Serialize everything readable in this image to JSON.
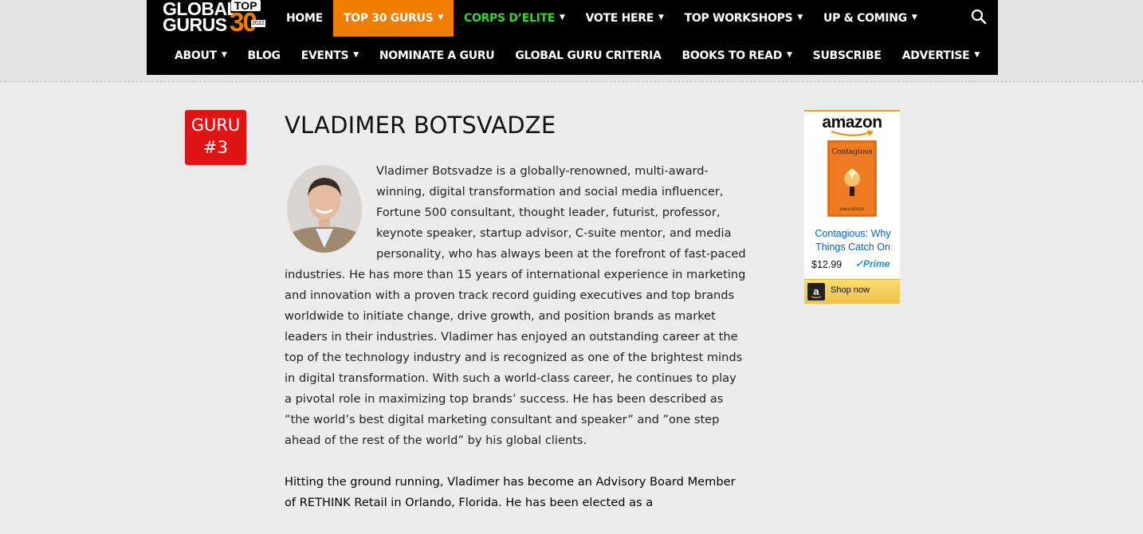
{
  "logo": {
    "line1": "GLOBAL",
    "line2": "GURUS",
    "top_label": "TOP",
    "number": "30",
    "year": "2022"
  },
  "nav": {
    "row1": [
      {
        "label": "HOME",
        "dropdown": false
      },
      {
        "label": "TOP 30 GURUS",
        "dropdown": true,
        "active": true
      },
      {
        "label": "CORPS D’ELITE",
        "dropdown": true,
        "highlight": "#34d62f"
      },
      {
        "label": "VOTE HERE",
        "dropdown": true
      },
      {
        "label": "TOP WORKSHOPS",
        "dropdown": true
      },
      {
        "label": "UP & COMING",
        "dropdown": true
      }
    ],
    "row2": [
      {
        "label": "ABOUT",
        "dropdown": true
      },
      {
        "label": "BLOG",
        "dropdown": false
      },
      {
        "label": "EVENTS",
        "dropdown": true
      },
      {
        "label": "NOMINATE A GURU",
        "dropdown": false
      },
      {
        "label": "GLOBAL GURU CRITERIA",
        "dropdown": false
      },
      {
        "label": "BOOKS TO READ",
        "dropdown": true
      },
      {
        "label": "SUBSCRIBE",
        "dropdown": false
      },
      {
        "label": "ADVERTISE",
        "dropdown": true
      }
    ],
    "search_icon": "search-icon",
    "chevron_icon": "chevron-down-icon"
  },
  "badge": {
    "line1": "GURU",
    "line2": "#3"
  },
  "title": "VLADIMER BOTSVADZE",
  "article": {
    "paragraphs": [
      "Vladimer Botsvadze is a globally-renowned, multi-award-winning, digital transformation and social media influencer, Fortune 500 consultant, thought leader, futurist, professor, keynote speaker, startup advisor, C-suite mentor, and media personality, who has always been at the forefront of fast-paced industries. He has more than 15 years of international experience in marketing and innovation with a proven track record guiding executives and top brands worldwide to initiate change, drive growth, and position brands as market leaders in their industries. Vladimer has enjoyed an outstanding career at the top of the technology industry and is recognized as one of the brightest minds in digital transformation. With such a world-class career, he continues to play a pivotal role in maximizing top brands’ success. He has been described as ”the world’s best digital marketing consultant and speaker” and ”one step ahead of the rest of the world” by his global clients.",
      "Hitting the ground running, Vladimer has become an Advisory Board Member of RETHINK Retail in Orlando, Florida. He has been elected as a"
    ]
  },
  "ad": {
    "brand": "amazon",
    "product_title": "Contagious: Why Things Catch On",
    "price": "$12.99",
    "prime": "✓Prime",
    "button": "Shop now",
    "book_cover_title": "Contagious",
    "book_author": "JONAH BERGER",
    "colors": {
      "cover": "#ef7b20",
      "link": "#0066c0",
      "button": "#f0c14b"
    }
  }
}
